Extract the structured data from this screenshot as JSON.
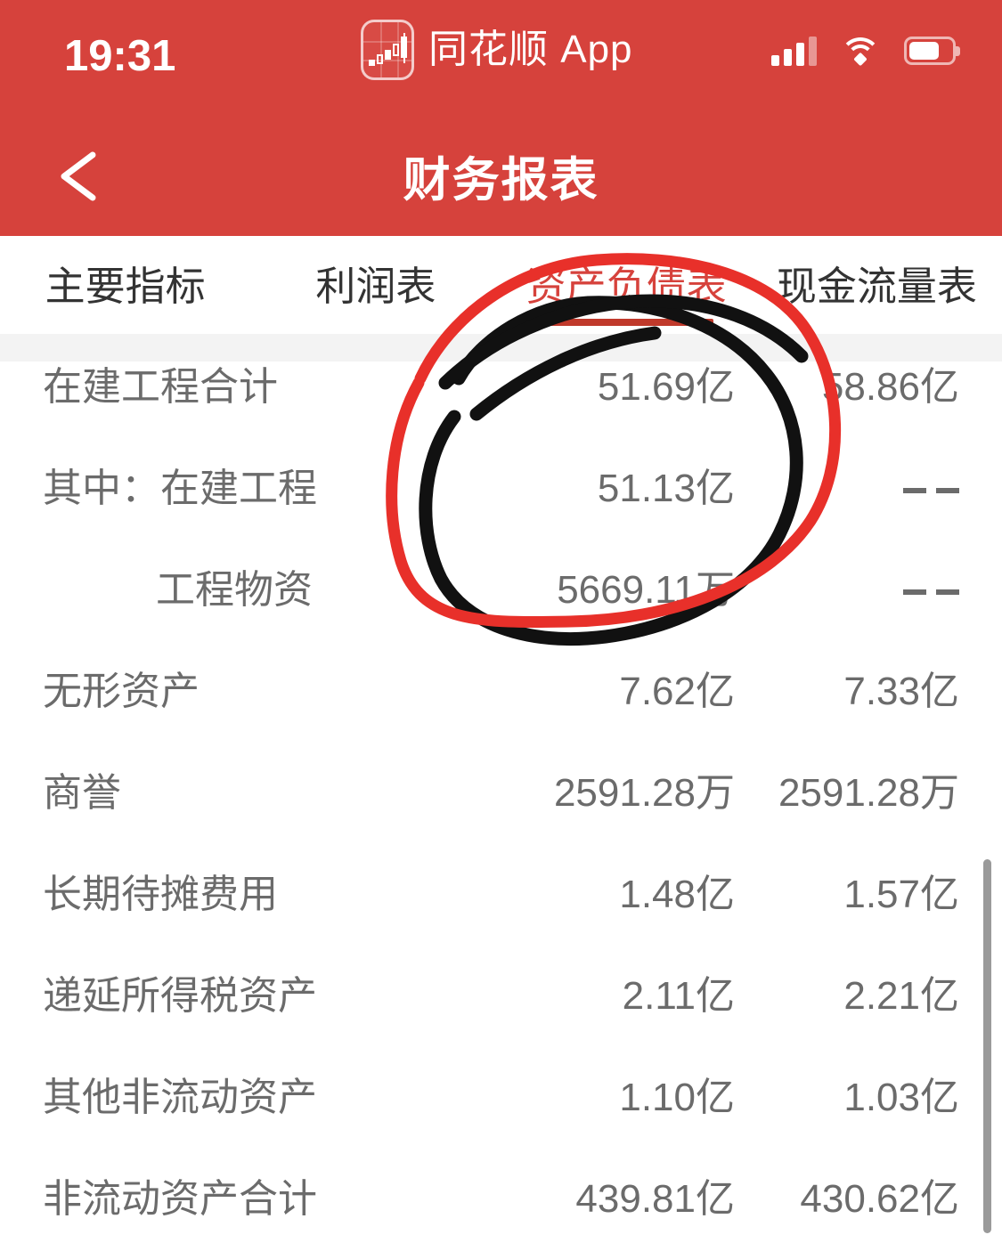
{
  "status_bar": {
    "time": "19:31",
    "carrier_label": "同花顺 App",
    "app_icon": "candlestick-chart-icon",
    "signal_icon": "signal-bars-icon",
    "wifi_icon": "wifi-icon",
    "battery_icon": "battery-icon",
    "signal_bars_filled": 3,
    "signal_bars_total": 4,
    "battery_level_percent": 70
  },
  "nav": {
    "back_icon": "chevron-left-icon",
    "title": "财务报表"
  },
  "tabs": [
    {
      "label": "主要指标",
      "active": false
    },
    {
      "label": "利润表",
      "active": false
    },
    {
      "label": "资产负债表",
      "active": true
    },
    {
      "label": "现金流量表",
      "active": false
    }
  ],
  "table": {
    "rows": [
      {
        "name": "在建工程合计",
        "indent": false,
        "col1": "51.69亿",
        "col2": "58.86亿",
        "col1_dash": false,
        "col2_dash": false
      },
      {
        "name": "其中：在建工程",
        "indent": false,
        "col1": "51.13亿",
        "col2": "--",
        "col1_dash": false,
        "col2_dash": true
      },
      {
        "name": "工程物资",
        "indent": true,
        "col1": "5669.11万",
        "col2": "--",
        "col1_dash": false,
        "col2_dash": true
      },
      {
        "name": "无形资产",
        "indent": false,
        "col1": "7.62亿",
        "col2": "7.33亿",
        "col1_dash": false,
        "col2_dash": false
      },
      {
        "name": "商誉",
        "indent": false,
        "col1": "2591.28万",
        "col2": "2591.28万",
        "col1_dash": false,
        "col2_dash": false
      },
      {
        "name": "长期待摊费用",
        "indent": false,
        "col1": "1.48亿",
        "col2": "1.57亿",
        "col1_dash": false,
        "col2_dash": false
      },
      {
        "name": "递延所得税资产",
        "indent": false,
        "col1": "2.11亿",
        "col2": "2.21亿",
        "col1_dash": false,
        "col2_dash": false
      },
      {
        "name": "其他非流动资产",
        "indent": false,
        "col1": "1.10亿",
        "col2": "1.03亿",
        "col1_dash": false,
        "col2_dash": false
      },
      {
        "name": "非流动资产合计",
        "indent": false,
        "col1": "439.81亿",
        "col2": "430.62亿",
        "col1_dash": false,
        "col2_dash": false
      }
    ]
  },
  "scrollbar": {
    "name": "vertical-scrollbar"
  },
  "annotations": [
    {
      "name": "red-circle-annotation",
      "color": "#e8302a",
      "shape": "hand-drawn-ellipse"
    },
    {
      "name": "black-circle-annotation",
      "color": "#111111",
      "shape": "hand-drawn-ellipse"
    },
    {
      "name": "black-swirl-annotation",
      "color": "#111111",
      "shape": "hand-drawn-arc"
    }
  ],
  "colors": {
    "header_red": "#d6423c",
    "tab_active_red": "#d6423c",
    "tab_underline_red": "#c0392b",
    "text_gray": "#6b6b6b",
    "tab_inactive": "#333333",
    "strip_gray": "#f3f3f3",
    "scrollbar_gray": "#9a9a9a"
  }
}
